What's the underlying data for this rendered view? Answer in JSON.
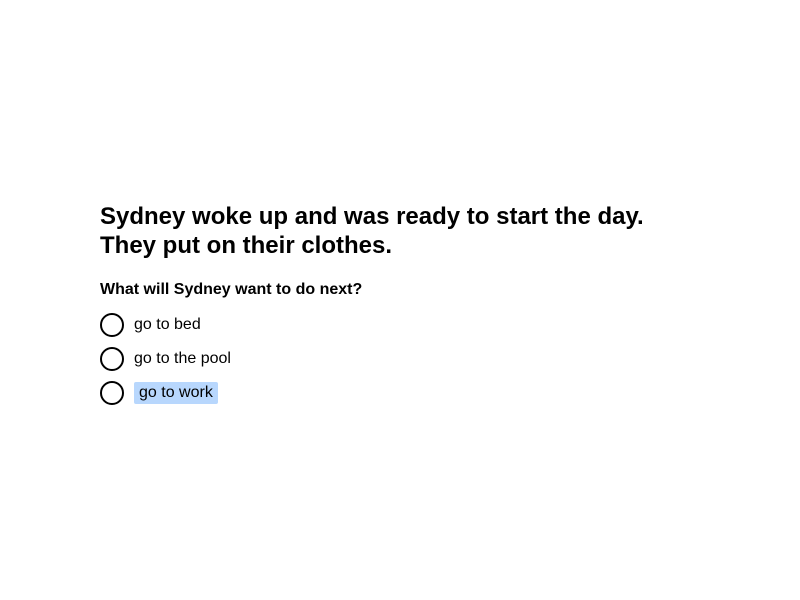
{
  "story": {
    "line1": "Sydney woke up and was ready to start the day.",
    "line2": "They put on their clothes."
  },
  "question": "What will Sydney want to do next?",
  "options": [
    {
      "label": "go to bed",
      "highlighted": false
    },
    {
      "label": "go to the pool",
      "highlighted": false
    },
    {
      "label": "go to work",
      "highlighted": true
    }
  ],
  "colors": {
    "highlight": "#b8d7fd",
    "text": "#000000",
    "background": "#ffffff"
  }
}
